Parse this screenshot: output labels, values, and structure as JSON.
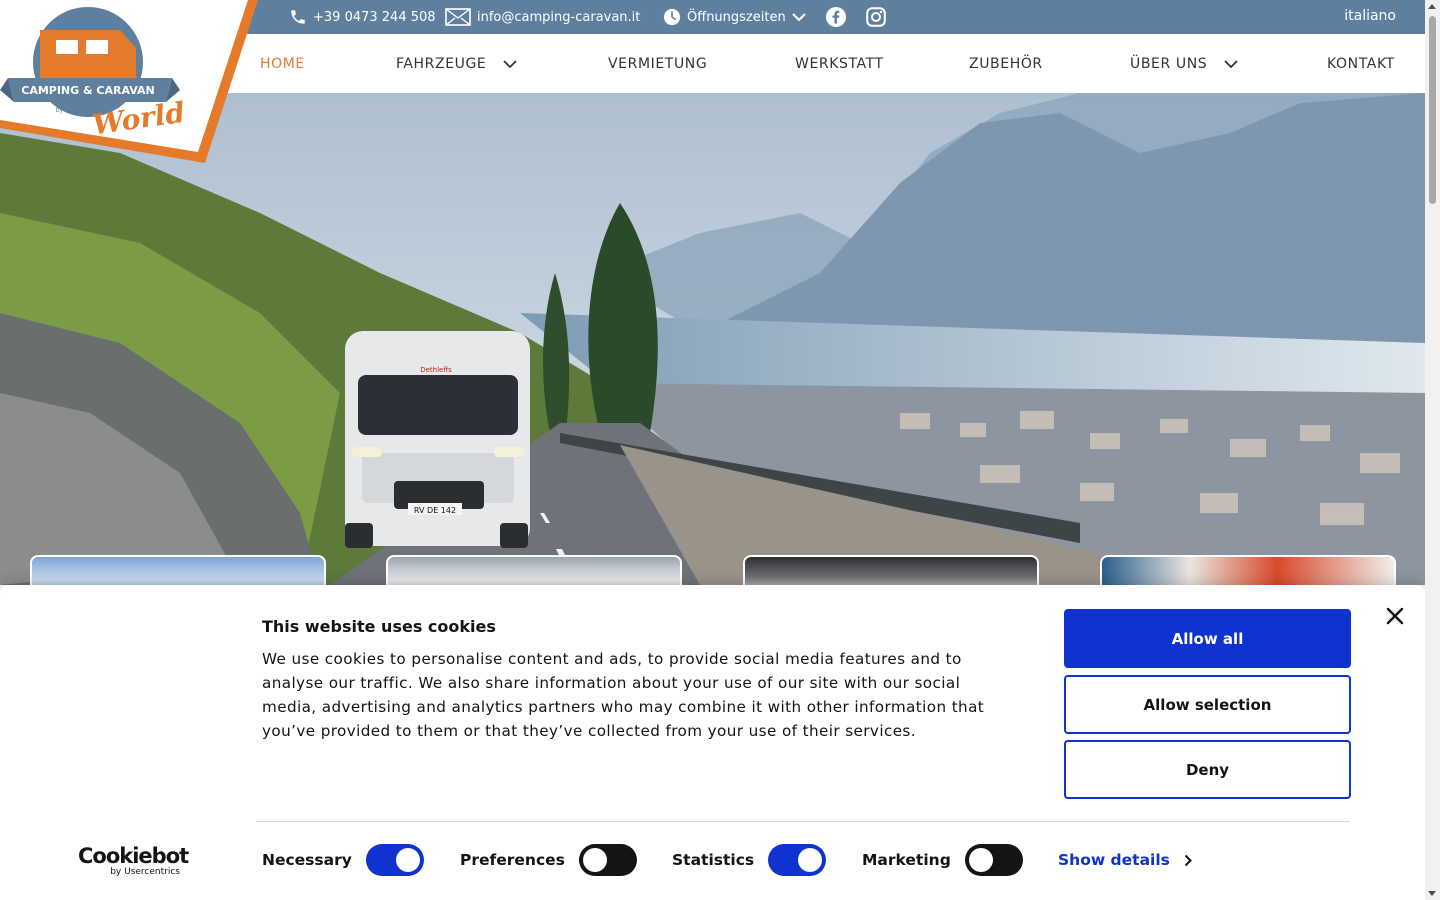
{
  "topbar": {
    "phone": "+39 0473 244 508",
    "email": "info@camping-caravan.it",
    "hours": "Öffnungszeiten",
    "language": "italiano",
    "bg_color": "#5f7f9f"
  },
  "logo": {
    "line1": "CAMPING & CARAVAN",
    "line2": "World",
    "line3": "by IDEALservice"
  },
  "nav": {
    "items": [
      {
        "label": "HOME",
        "active": true
      },
      {
        "label": "FAHRZEUGE",
        "dropdown": true
      },
      {
        "label": "VERMIETUNG"
      },
      {
        "label": "WERKSTATT"
      },
      {
        "label": "ZUBEHÖR"
      },
      {
        "label": "ÜBER UNS",
        "dropdown": true
      },
      {
        "label": "KONTAKT"
      }
    ],
    "active_color": "#e57a2a"
  },
  "hero": {
    "plate": "RV DE 142",
    "van_brand": "Dethleffs"
  },
  "cookie": {
    "title": "This website uses cookies",
    "body": "We use cookies to personalise content and ads, to provide social media features and to analyse our traffic. We also share information about your use of our site with our social media, advertising and analytics partners who may combine it with other information that you’ve provided to them or that they’ve collected from your use of their services.",
    "buttons": {
      "allow_all": "Allow all",
      "allow_selection": "Allow selection",
      "deny": "Deny"
    },
    "toggles": [
      {
        "label": "Necessary",
        "on": true
      },
      {
        "label": "Preferences",
        "on": false
      },
      {
        "label": "Statistics",
        "on": true
      },
      {
        "label": "Marketing",
        "on": false
      }
    ],
    "show_details": "Show details",
    "brand": "Cookiebot",
    "brand_by": "by Usercentrics",
    "accent_color": "#1032cf"
  }
}
